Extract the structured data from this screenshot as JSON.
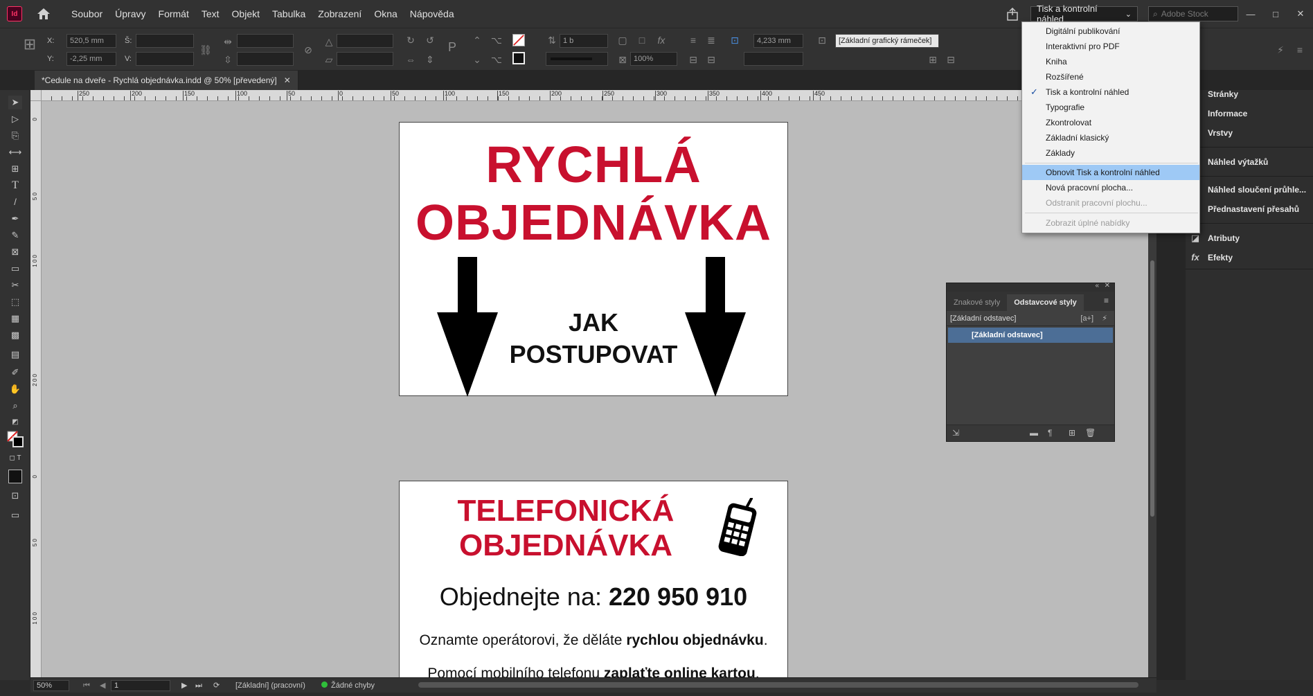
{
  "app": {
    "icon_text": "Id"
  },
  "menubar": {
    "items": [
      "Soubor",
      "Úpravy",
      "Formát",
      "Text",
      "Objekt",
      "Tabulka",
      "Zobrazení",
      "Okna",
      "Nápověda"
    ],
    "workspace": "Tisk a kontrolní náhled",
    "stock_placeholder": "Adobe Stock",
    "window_controls": [
      "—",
      "□",
      "✕"
    ]
  },
  "controlbar": {
    "x_label": "X:",
    "x_value": "520,5 mm",
    "y_label": "Y:",
    "y_value": "-2,25 mm",
    "w_label": "Š:",
    "h_label": "V:",
    "stroke_weight": "1 b",
    "scale": "100%",
    "spacing": "4,233 mm",
    "frame_style": "[Základní grafický rámeček]"
  },
  "document": {
    "tab_title": "*Cedule na dveře - Rychlá objednávka.indd @ 50% [převedený]",
    "close": "✕"
  },
  "rulers": {
    "top": [
      "250",
      "200",
      "150",
      "100",
      "50",
      "0",
      "50",
      "100",
      "150",
      "200",
      "250",
      "300",
      "350",
      "400",
      "450"
    ],
    "left": [
      "0",
      "5 0",
      "1 0 0",
      "2 0 0",
      "0",
      "5 0",
      "1 0 0"
    ]
  },
  "page1": {
    "title_line1": "RYCHLÁ",
    "title_line2": "OBJEDNÁVKA",
    "sub_line1": "JAK",
    "sub_line2": "POSTUPOVAT"
  },
  "page2": {
    "title_line1": "TELEFONICKÁ",
    "title_line2": "OBJEDNÁVKA",
    "order_prefix": "Objednejte na: ",
    "phone": "220 950 910",
    "info1_prefix": "Oznamte operátorovi, že děláte ",
    "info1_bold": "rychlou objednávku",
    "info1_suffix": ".",
    "info2_prefix": "Pomocí mobilního telefonu ",
    "info2_bold": "zaplaťte online kartou",
    "info2_suffix": "."
  },
  "statusbar": {
    "zoom": "50%",
    "page": "1",
    "style": "[Základní] (pracovní)",
    "preflight": "Žádné chyby",
    "colors": {
      "ok_dot": "#2fbf3a"
    }
  },
  "dock": {
    "items": [
      "Stránky",
      "Informace",
      "Vrstvy",
      "Náhled výtažků",
      "Náhled sloučení průhle...",
      "Přednastavení přesahů",
      "Atributy",
      "Efekty"
    ]
  },
  "para_panel": {
    "tab_inactive": "Znakové styly",
    "tab_active": "Odstavcové styly",
    "current": "[Základní odstavec]",
    "list_item": "[Základní odstavec]"
  },
  "ws_dropdown": {
    "items": [
      "Digitální publikování",
      "Interaktivní pro PDF",
      "Kniha",
      "Rozšířené",
      "Tisk a kontrolní náhled",
      "Typografie",
      "Zkontrolovat",
      "Základní klasický",
      "Základy"
    ],
    "checked_index": 4,
    "reset": "Obnovit Tisk a kontrolní náhled",
    "new_ws": "Nová pracovní plocha...",
    "delete_ws": "Odstranit pracovní plochu...",
    "show_full": "Zobrazit úplné nabídky"
  },
  "colors": {
    "accent_red": "#c8102e",
    "highlight": "#9ec9f5",
    "selected_row": "#4c6e96"
  }
}
